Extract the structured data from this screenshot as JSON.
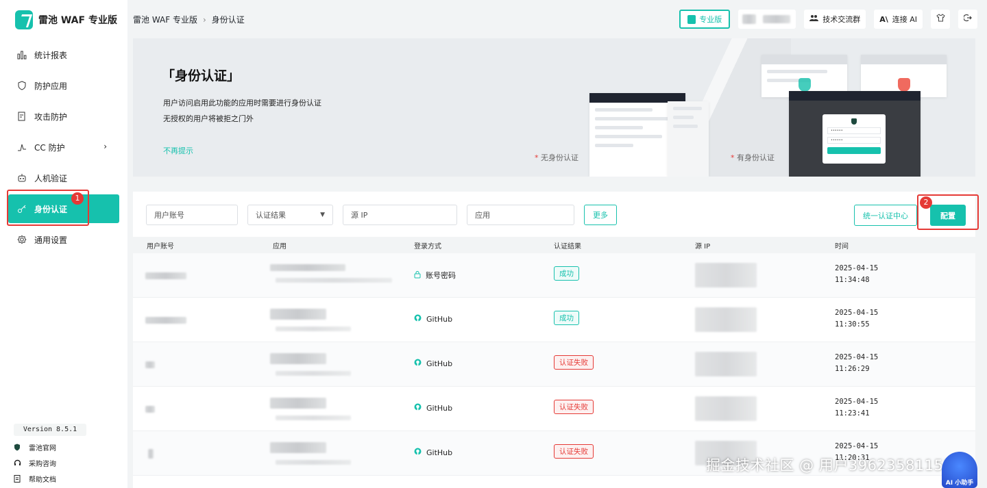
{
  "app": {
    "name": "雷池 WAF 专业版"
  },
  "breadcrumb": [
    "雷池 WAF 专业版",
    "身份认证"
  ],
  "topbar": {
    "pro_label": "专业版",
    "group_label": "技术交流群",
    "ai_label": "连接 AI"
  },
  "sidebar": {
    "items": [
      {
        "label": "统计报表",
        "icon": "bar-chart-icon"
      },
      {
        "label": "防护应用",
        "icon": "shield-icon"
      },
      {
        "label": "攻击防护",
        "icon": "document-check-icon"
      },
      {
        "label": "CC 防护",
        "icon": "pulse-icon"
      },
      {
        "label": "人机验证",
        "icon": "robot-icon"
      },
      {
        "label": "身份认证",
        "icon": "key-icon",
        "active": true
      },
      {
        "label": "通用设置",
        "icon": "gear-icon"
      }
    ],
    "version": "Version 8.5.1",
    "footer_links": [
      "雷池官网",
      "采购咨询",
      "帮助文档"
    ]
  },
  "annotations": {
    "marker1": "1",
    "marker2": "2"
  },
  "banner": {
    "title": "「身份认证」",
    "line1": "用户访问启用此功能的应用时需要进行身份认证",
    "line2": "无授权的用户将被拒之门外",
    "dismiss": "不再提示",
    "caption_without": "无身份认证",
    "caption_with": "有身份认证",
    "caption_star": "*",
    "pw_mask": "••••••"
  },
  "filters": {
    "user_placeholder": "用户账号",
    "result_select": "认证结果",
    "ip_placeholder": "源 IP",
    "app_placeholder": "应用",
    "more": "更多",
    "sso_center": "统一认证中心",
    "config": "配置"
  },
  "table": {
    "headers": [
      "用户账号",
      "应用",
      "登录方式",
      "认证结果",
      "源 IP",
      "时间"
    ],
    "rows": [
      {
        "method": "账号密码",
        "method_icon": "lock-icon",
        "result": "成功",
        "status": "ok",
        "date": "2025-04-15",
        "time": "11:34:48"
      },
      {
        "method": "GitHub",
        "method_icon": "github-icon",
        "result": "成功",
        "status": "ok",
        "date": "2025-04-15",
        "time": "11:30:55"
      },
      {
        "method": "GitHub",
        "method_icon": "github-icon",
        "result": "认证失败",
        "status": "fail",
        "date": "2025-04-15",
        "time": "11:26:29"
      },
      {
        "method": "GitHub",
        "method_icon": "github-icon",
        "result": "认证失败",
        "status": "fail",
        "date": "2025-04-15",
        "time": "11:23:41"
      },
      {
        "method": "GitHub",
        "method_icon": "github-icon",
        "result": "认证失败",
        "status": "fail",
        "date": "2025-04-15",
        "time": "11:20:31"
      }
    ]
  },
  "watermark": "掘金技术社区 @ 用户3962358115​3",
  "ai_assistant": "AI 小助手",
  "colors": {
    "accent": "#16c1ad",
    "danger": "#e53935"
  }
}
